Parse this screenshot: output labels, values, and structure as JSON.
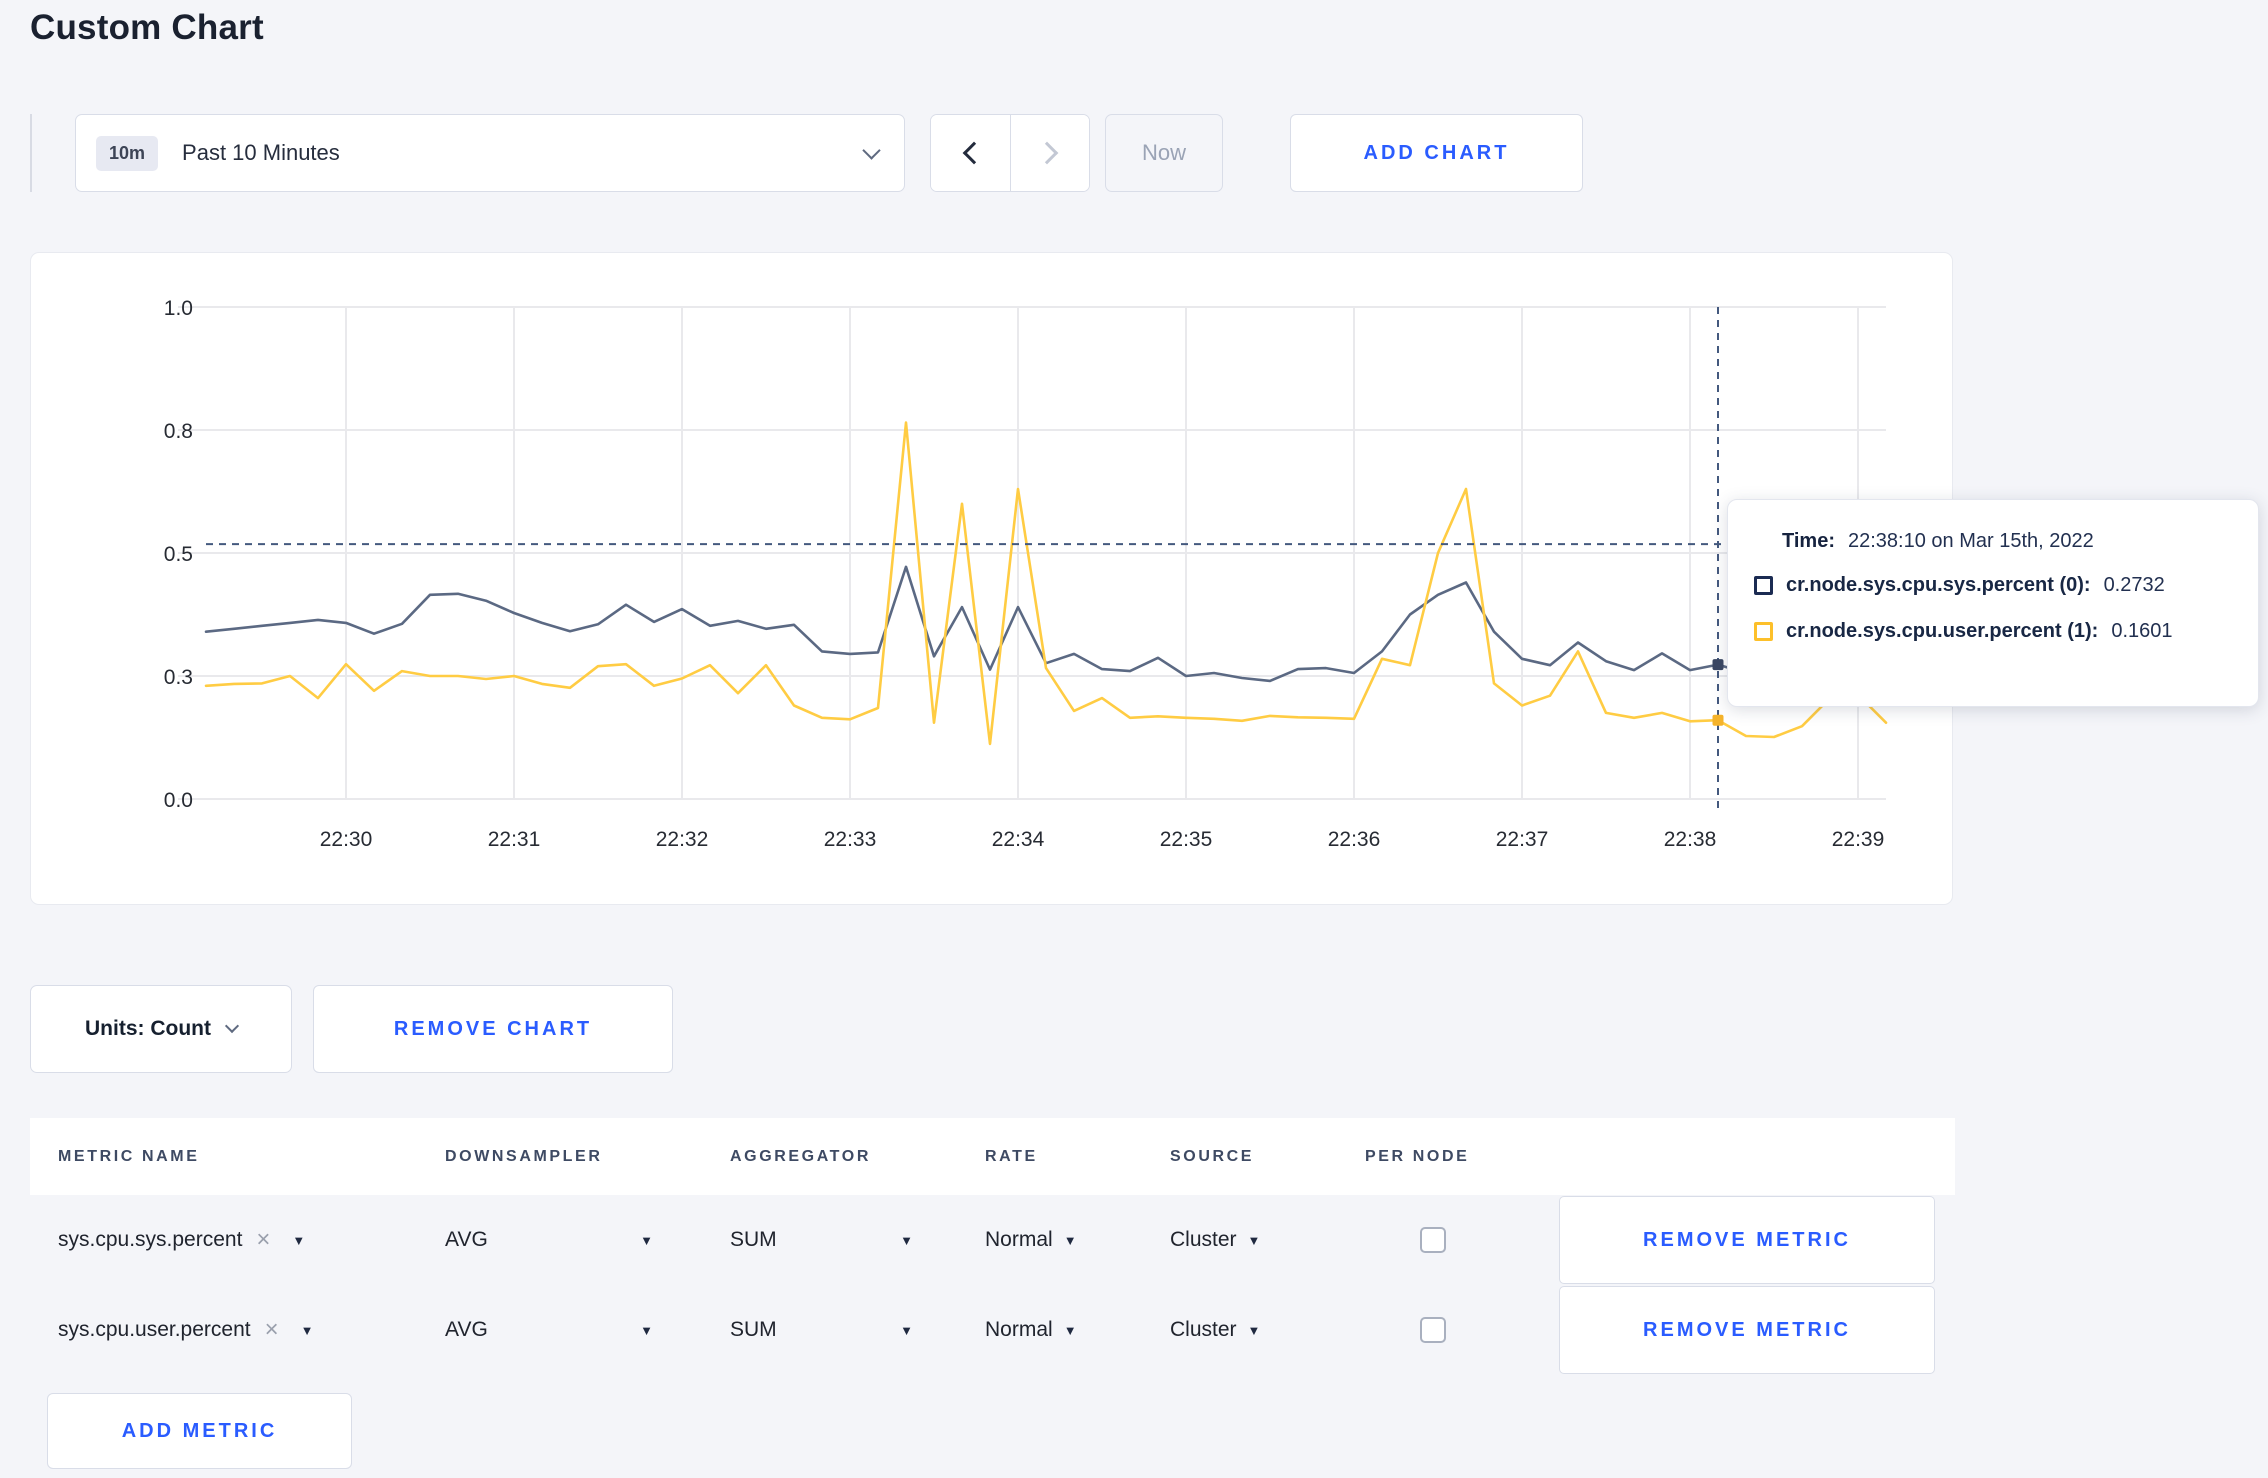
{
  "page": {
    "title": "Custom Chart",
    "background": "#f4f5f9",
    "accent_blue": "#2a5cff"
  },
  "icons": {
    "close": "×",
    "caret_down": "▼"
  },
  "toolbar": {
    "time_range": {
      "badge": "10m",
      "label": "Past 10 Minutes"
    },
    "now_label": "Now",
    "add_chart_label": "ADD CHART"
  },
  "chart": {
    "tooltip": {
      "time_label": "Time:",
      "time_value": "22:38:10 on Mar 15th, 2022",
      "rows": [
        {
          "name": "cr.node.sys.cpu.sys.percent (0):",
          "value": "0.2732",
          "swatch_color": "#1b2b52"
        },
        {
          "name": "cr.node.sys.cpu.user.percent (1):",
          "value": "0.1601",
          "swatch_color": "#fdc02a"
        }
      ]
    }
  },
  "chart_data": {
    "type": "line",
    "title": "",
    "xlabel": "",
    "ylabel": "",
    "ylim": [
      0,
      1
    ],
    "grid": true,
    "legend_position": "tooltip",
    "x_start": "22:29:10",
    "x_interval_seconds": 10,
    "x_tick_labels": [
      "22:30",
      "22:31",
      "22:32",
      "22:33",
      "22:34",
      "22:35",
      "22:36",
      "22:37",
      "22:38",
      "22:39"
    ],
    "x_tick_start_offset_seconds": 50,
    "x_tick_interval_seconds": 60,
    "y_ticks": [
      {
        "value": 0,
        "label": "0.0"
      },
      {
        "value": 0.25,
        "label": "0.3"
      },
      {
        "value": 0.5,
        "label": "0.5"
      },
      {
        "value": 0.75,
        "label": "0.8"
      },
      {
        "value": 1,
        "label": "1.0"
      }
    ],
    "crosshair": {
      "time": "22:38:10",
      "x_index": 54,
      "y_value": 0.518
    },
    "series": [
      {
        "name": "cr.node.sys.cpu.sys.percent",
        "color": "#5b6983",
        "marker_color": "#3a4763",
        "values": [
          0.34,
          0.346,
          0.352,
          0.358,
          0.364,
          0.358,
          0.336,
          0.356,
          0.415,
          0.417,
          0.403,
          0.378,
          0.358,
          0.341,
          0.355,
          0.395,
          0.36,
          0.386,
          0.352,
          0.362,
          0.346,
          0.354,
          0.3,
          0.295,
          0.298,
          0.472,
          0.29,
          0.39,
          0.263,
          0.39,
          0.276,
          0.295,
          0.264,
          0.26,
          0.287,
          0.25,
          0.256,
          0.246,
          0.24,
          0.264,
          0.266,
          0.256,
          0.3,
          0.375,
          0.415,
          0.44,
          0.34,
          0.285,
          0.272,
          0.318,
          0.28,
          0.262,
          0.296,
          0.262,
          0.2732,
          0.256,
          0.262,
          0.252,
          0.264,
          0.256,
          0.26
        ]
      },
      {
        "name": "cr.node.sys.cpu.user.percent",
        "color": "#ffcc43",
        "marker_color": "#f5b32b",
        "values": [
          0.23,
          0.234,
          0.235,
          0.25,
          0.205,
          0.274,
          0.22,
          0.26,
          0.25,
          0.25,
          0.244,
          0.25,
          0.234,
          0.226,
          0.27,
          0.274,
          0.23,
          0.245,
          0.272,
          0.215,
          0.272,
          0.19,
          0.165,
          0.162,
          0.185,
          0.765,
          0.155,
          0.6,
          0.112,
          0.63,
          0.266,
          0.179,
          0.205,
          0.165,
          0.168,
          0.165,
          0.163,
          0.159,
          0.169,
          0.166,
          0.165,
          0.163,
          0.285,
          0.272,
          0.5,
          0.63,
          0.235,
          0.19,
          0.21,
          0.3,
          0.175,
          0.165,
          0.175,
          0.158,
          0.1601,
          0.128,
          0.126,
          0.148,
          0.205,
          0.212,
          0.155
        ]
      }
    ]
  },
  "chart_footer": {
    "units_label": "Units: Count",
    "remove_chart_label": "REMOVE CHART"
  },
  "metrics": {
    "headers": [
      "METRIC NAME",
      "DOWNSAMPLER",
      "AGGREGATOR",
      "RATE",
      "SOURCE",
      "PER NODE"
    ],
    "rows": [
      {
        "name": "sys.cpu.sys.percent",
        "downsampler": "AVG",
        "aggregator": "SUM",
        "rate": "Normal",
        "source": "Cluster",
        "per_node_checked": false
      },
      {
        "name": "sys.cpu.user.percent",
        "downsampler": "AVG",
        "aggregator": "SUM",
        "rate": "Normal",
        "source": "Cluster",
        "per_node_checked": false
      }
    ],
    "remove_metric_label": "REMOVE METRIC",
    "add_metric_label": "ADD METRIC"
  }
}
